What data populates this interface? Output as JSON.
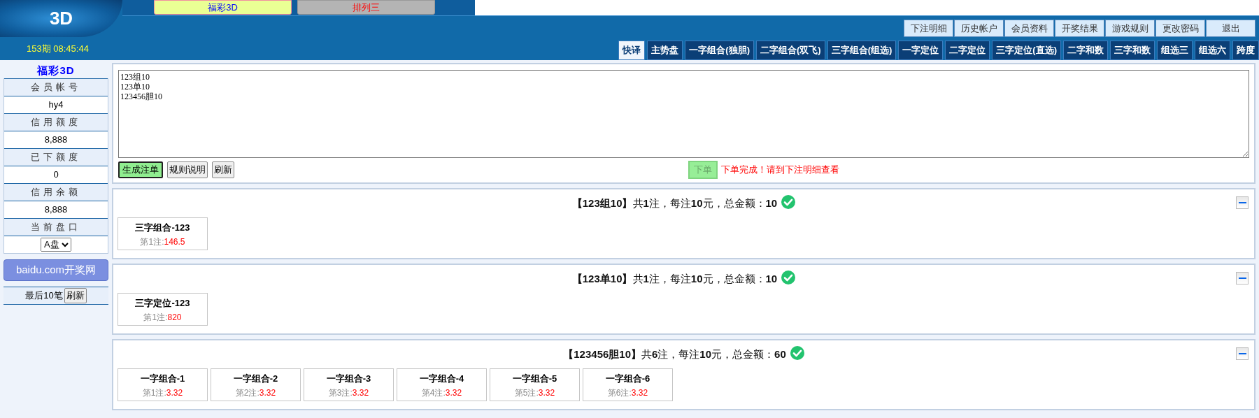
{
  "header": {
    "logo": "3D",
    "period": "153期 08:45:44",
    "lotteries": [
      {
        "label": "福彩3D",
        "selected": true
      },
      {
        "label": "排列三",
        "selected": false
      }
    ],
    "nav": [
      "下注明细",
      "历史帐户",
      "会员资料",
      "开奖结果",
      "游戏规则",
      "更改密码",
      "退出"
    ],
    "game_tabs": [
      {
        "label": "快译",
        "selected": true
      },
      {
        "label": "主势盘",
        "selected": false
      },
      {
        "label": "一字组合(独胆)",
        "selected": false
      },
      {
        "label": "二字组合(双飞)",
        "selected": false
      },
      {
        "label": "三字组合(组选)",
        "selected": false
      },
      {
        "label": "一字定位",
        "selected": false
      },
      {
        "label": "二字定位",
        "selected": false
      },
      {
        "label": "三字定位(直选)",
        "selected": false
      },
      {
        "label": "二字和数",
        "selected": false
      },
      {
        "label": "三字和数",
        "selected": false
      },
      {
        "label": "组选三",
        "selected": false
      },
      {
        "label": "组选六",
        "selected": false
      },
      {
        "label": "跨度",
        "selected": false
      }
    ]
  },
  "sidebar": {
    "title": "福彩3D",
    "fields": [
      {
        "label": "会员帐号",
        "value": "hy4"
      },
      {
        "label": "信用额度",
        "value": "8,888"
      },
      {
        "label": "已下额度",
        "value": "0"
      },
      {
        "label": "信用余额",
        "value": "8,888"
      }
    ],
    "market": {
      "label": "当前盘口",
      "value": "A盘"
    },
    "link": "baidu.com开奖网",
    "recent": {
      "label": "最后10笔",
      "button": "刷新"
    }
  },
  "entry": {
    "value": "123组10\n123单10\n123456胆10",
    "buttons": [
      {
        "label": "生成注单",
        "kind": "primary"
      },
      {
        "label": "规则说明",
        "kind": "plain"
      },
      {
        "label": "刷新",
        "kind": "plain"
      }
    ],
    "submit": {
      "label": "下单",
      "disabled": true
    },
    "status": "下单完成！请到下注明细查看"
  },
  "results": [
    {
      "summary": "**【123组10】**共**1**注，每注**10**元，总金额：**10**",
      "confirmed": true,
      "expanded": true,
      "bets": [
        {
          "title": "三字组合-123",
          "label": "第1注:",
          "value": "146.5"
        }
      ]
    },
    {
      "summary": "**【123单10】**共**1**注，每注**10**元，总金额：**10**",
      "confirmed": true,
      "expanded": true,
      "bets": [
        {
          "title": "三字定位-123",
          "label": "第1注:",
          "value": "820"
        }
      ]
    },
    {
      "summary": "**【123456胆10】**共**6**注，每注**10**元，总金额：**60**",
      "confirmed": true,
      "expanded": true,
      "bets": [
        {
          "title": "一字组合-1",
          "label": "第1注:",
          "value": "3.32"
        },
        {
          "title": "一字组合-2",
          "label": "第2注:",
          "value": "3.32"
        },
        {
          "title": "一字组合-3",
          "label": "第3注:",
          "value": "3.32"
        },
        {
          "title": "一字组合-4",
          "label": "第4注:",
          "value": "3.32"
        },
        {
          "title": "一字组合-5",
          "label": "第5注:",
          "value": "3.32"
        },
        {
          "title": "一字组合-6",
          "label": "第6注:",
          "value": "3.32"
        }
      ]
    }
  ]
}
